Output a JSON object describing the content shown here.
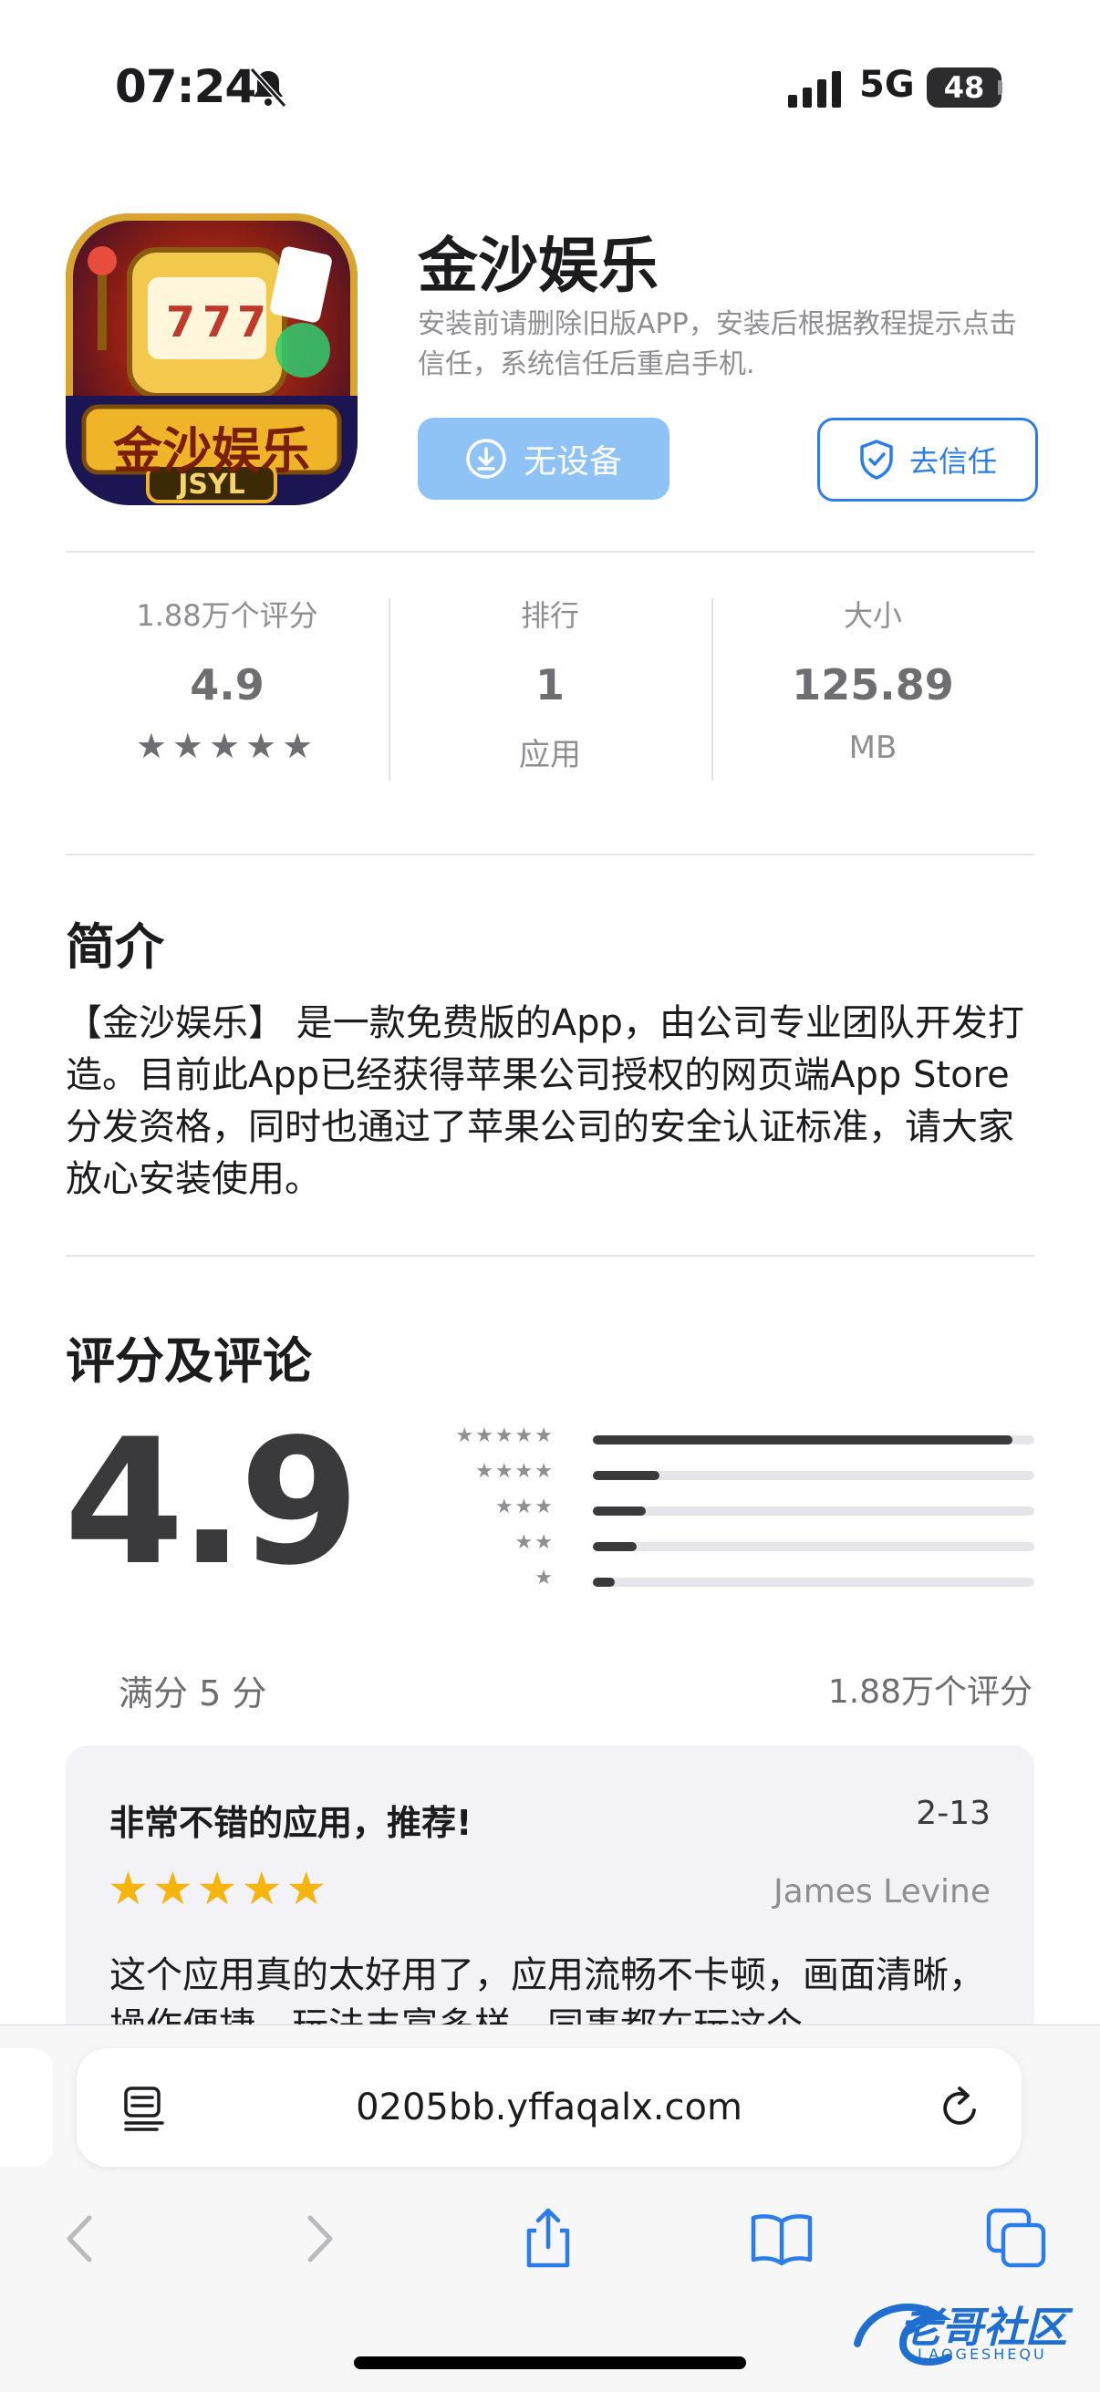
{
  "status_bar": {
    "time": "07:24",
    "network": "5G",
    "battery": "48"
  },
  "app": {
    "name": "金沙娱乐",
    "subtitle": "安装前请删除旧版APP，安装后根据教程提示点击信任，系统信任后重启手机.",
    "icon_text": "金沙娱乐",
    "icon_text2": "JSYL",
    "install_button": "无设备",
    "trust_button": "去信任"
  },
  "stats": {
    "ratings": {
      "label": "1.88万个评分",
      "value": "4.9",
      "stars": "★★★★★"
    },
    "rank": {
      "label": "排行",
      "value": "1",
      "sub": "应用"
    },
    "size": {
      "label": "大小",
      "value": "125.89",
      "sub": "MB"
    }
  },
  "intro": {
    "heading": "简介",
    "text": "【金沙娱乐】 是一款免费版的App，由公司专业团队开发打造。目前此App已经获得苹果公司授权的网页端App Store分发资格，同时也通过了苹果公司的安全认证标准，请大家放心安装使用。"
  },
  "ratings": {
    "heading": "评分及评论",
    "score": "4.9",
    "out_of": "满分 5 分",
    "count": "1.88万个评分",
    "distribution": [
      {
        "stars": "★★★★★",
        "fraction": 0.95
      },
      {
        "stars": "★★★★",
        "fraction": 0.15
      },
      {
        "stars": "★★★",
        "fraction": 0.12
      },
      {
        "stars": "★★",
        "fraction": 0.1
      },
      {
        "stars": "★",
        "fraction": 0.05
      }
    ]
  },
  "review": {
    "title": "非常不错的应用，推荐!",
    "date": "2-13",
    "stars": "★★★★★",
    "author": "James Levine",
    "body": "这个应用真的太好用了，应用流畅不卡顿，画面清晰，操作便捷，玩法丰富多样，同事都在玩这个"
  },
  "browser": {
    "url": "0205bb.yffaqalx.com"
  },
  "watermark": {
    "text": "老哥社区",
    "sub": "LAOGESHEQU"
  },
  "colors": {
    "accent": "#2b7de9",
    "install_bg": "#8fc2f5",
    "star_gold": "#f6b40c"
  }
}
